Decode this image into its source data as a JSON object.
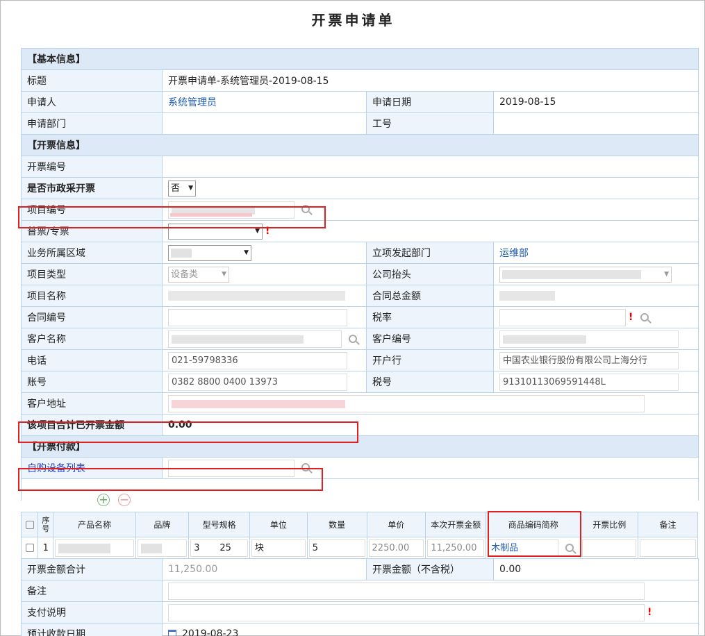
{
  "title": "开票申请单",
  "sections": {
    "basic": "【基本信息】",
    "invoice": "【开票信息】",
    "payment": "【开票付款】"
  },
  "basic": {
    "title_label": "标题",
    "title_value": "开票申请单-系统管理员-2019-08-15",
    "applicant_label": "申请人",
    "applicant_value": "系统管理员",
    "apply_date_label": "申请日期",
    "apply_date_value": "2019-08-15",
    "dept_label": "申请部门",
    "dept_value": "",
    "employee_no_label": "工号",
    "employee_no_value": ""
  },
  "invoice": {
    "invoice_no_label": "开票编号",
    "gov_label": "是否市政采开票",
    "gov_value": "否",
    "project_no_label": "项目编号",
    "type_label": "普票/专票",
    "type_value": "",
    "region_label": "业务所属区域",
    "start_dept_label": "立项发起部门",
    "start_dept_value": "运维部",
    "project_type_label": "项目类型",
    "project_type_value": "设备类",
    "company_header_label": "公司抬头",
    "project_name_label": "项目名称",
    "contract_total_label": "合同总金额",
    "contract_no_label": "合同编号",
    "tax_rate_label": "税率",
    "customer_name_label": "客户名称",
    "customer_no_label": "客户编号",
    "phone_label": "电话",
    "phone_value": "021-59798336",
    "bank_label": "开户行",
    "bank_value": "中国农业银行股份有限公司上海分行",
    "account_label": "账号",
    "account_value": "0382 8800 0400 13973",
    "tax_no_label": "税号",
    "tax_no_value": "91310113069591448L",
    "address_label": "客户地址",
    "invoiced_total_label": "该项目合计已开票金额",
    "invoiced_total_value": "0.00"
  },
  "payment": {
    "equipment_list_label": "自购设备列表-"
  },
  "detail": {
    "headers": [
      "序号",
      "产品名称",
      "品牌",
      "型号规格",
      "单位",
      "数量",
      "单价",
      "本次开票金额",
      "商品编码简称",
      "开票比例",
      "备注"
    ],
    "rows": [
      {
        "seq": "1",
        "product": "",
        "brand": "",
        "model": "3       25",
        "unit": "块",
        "qty": "5",
        "price": "2250.00",
        "amount": "11,250.00",
        "code_name": "木制品",
        "ratio": "",
        "note": ""
      }
    ]
  },
  "footer": {
    "total_label": "开票金额合计",
    "total_value": "11,250.00",
    "no_tax_label": "开票金额（不含税）",
    "no_tax_value": "0.00",
    "remark_label": "备注",
    "pay_note_label": "支付说明",
    "expected_date_label": "预计收款日期",
    "expected_date_value": "2019-08-23"
  },
  "colors": {
    "section_bg": "#dde9f6",
    "label_bg": "#edf4fb",
    "border": "#b9d4ea",
    "highlight_red": "#e02020",
    "link": "#1e5bb5"
  }
}
